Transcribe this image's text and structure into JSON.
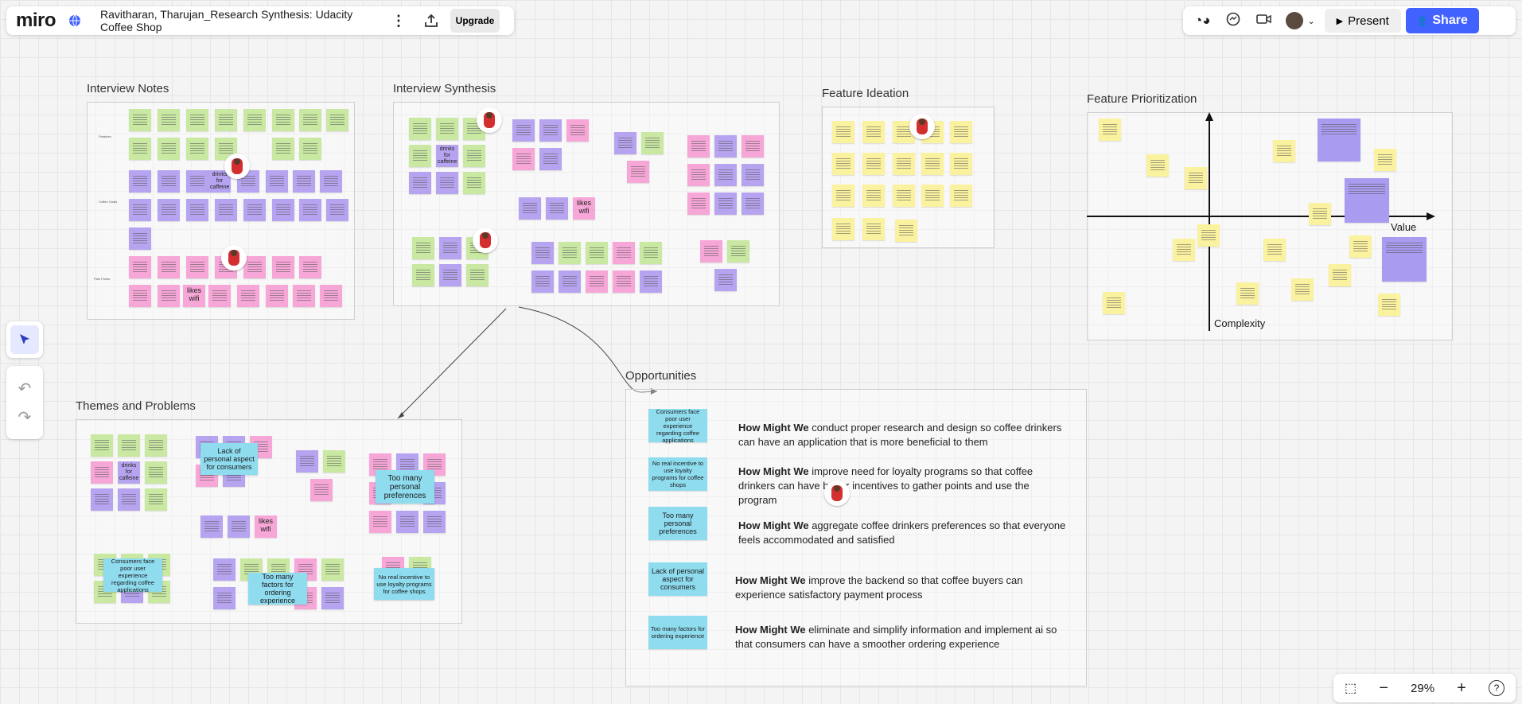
{
  "header": {
    "logo": "miro",
    "board_title": "Ravitharan, Tharujan_Research Synthesis: Udacity Coffee Shop",
    "upgrade_label": "Upgrade",
    "present_label": "Present",
    "share_label": "Share"
  },
  "frames": {
    "interview_notes": "Interview Notes",
    "interview_synthesis": "Interview Synthesis",
    "feature_ideation": "Feature Ideation",
    "feature_prioritization": "Feature Prioritization",
    "themes_problems": "Themes and Problems",
    "opportunities": "Opportunities"
  },
  "axis": {
    "value": "Value",
    "complexity": "Complexity"
  },
  "notes_text": {
    "likes_wifi": "likes wifi",
    "drinks_caffeine": "drinks for caffeine",
    "lack_personal": "Lack of personal aspect for consumers",
    "too_many_pref": "Too many personal preferences",
    "ux_poor": "Consumers face poor user experience regarding coffee applications",
    "too_many_factors": "Too many factors for ordering experience",
    "no_incentive": "No real incentive to use loyalty programs for coffee shops"
  },
  "opportunities": [
    {
      "note": "Consumers face poor user experience regarding coffee applications",
      "bold": "How Might We",
      "rest": " conduct proper research and design so coffee drinkers can have an application that is more beneficial to them"
    },
    {
      "note": "No real incentive to use loyalty programs for coffee shops",
      "bold": "How Might We",
      "rest": " improve need for loyalty programs so that coffee drinkers can have better incentives to gather points and use the program"
    },
    {
      "note": "Too many personal preferences",
      "bold": "How Might We",
      "rest": " aggregate coffee drinkers preferences so that everyone feels accommodated and satisfied"
    },
    {
      "note": "Lack of personal aspect for consumers",
      "bold": "How Might We",
      "rest": " improve the backend  so that coffee buyers can experience satisfactory payment process"
    },
    {
      "note": "Too many factors for ordering experience",
      "bold": "How Might We",
      "rest": " eliminate and simplify information and implement ai so that consumers can have a smoother ordering experience"
    }
  ],
  "zoom": {
    "level": "29%"
  },
  "icons": [
    "globe-icon",
    "more-icon",
    "upload-icon",
    "reactions-icon",
    "chat-icon",
    "video-icon",
    "play-icon",
    "share-user-icon",
    "cursor-icon",
    "undo-icon",
    "redo-icon",
    "fit-icon",
    "zoom-out-icon",
    "zoom-in-icon",
    "help-icon"
  ]
}
